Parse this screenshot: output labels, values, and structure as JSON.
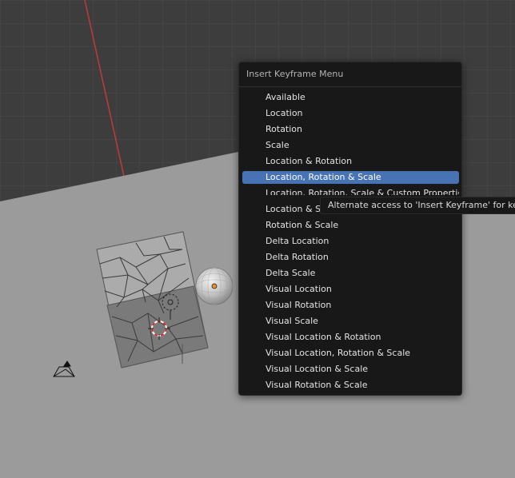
{
  "menu": {
    "title": "Insert Keyframe Menu",
    "items": [
      {
        "label": "Available"
      },
      {
        "label": "Location"
      },
      {
        "label": "Rotation"
      },
      {
        "label": "Scale"
      },
      {
        "label": "Location & Rotation"
      },
      {
        "label": "Location, Rotation & Scale",
        "active": true
      },
      {
        "label": "Location, Rotation, Scale & Custom Properties"
      },
      {
        "label": "Location & Scale"
      },
      {
        "label": "Rotation & Scale"
      },
      {
        "label": "Delta Location"
      },
      {
        "label": "Delta Rotation"
      },
      {
        "label": "Delta Scale"
      },
      {
        "label": "Visual Location"
      },
      {
        "label": "Visual Rotation"
      },
      {
        "label": "Visual Scale"
      },
      {
        "label": "Visual Location & Rotation"
      },
      {
        "label": "Visual Location, Rotation & Scale"
      },
      {
        "label": "Visual Location & Scale"
      },
      {
        "label": "Visual Rotation & Scale"
      }
    ]
  },
  "tooltip": {
    "text": "Alternate access to 'Insert Keyframe' for keymap items"
  },
  "colors": {
    "highlight": "#4772b3",
    "x_axis": "#c0393b",
    "y_axis": "#7fb82a",
    "origin": "#e8902a"
  },
  "viewport": {
    "icons": [
      "camera-icon",
      "light-icon",
      "3d-cursor-icon",
      "origin-icon"
    ]
  }
}
